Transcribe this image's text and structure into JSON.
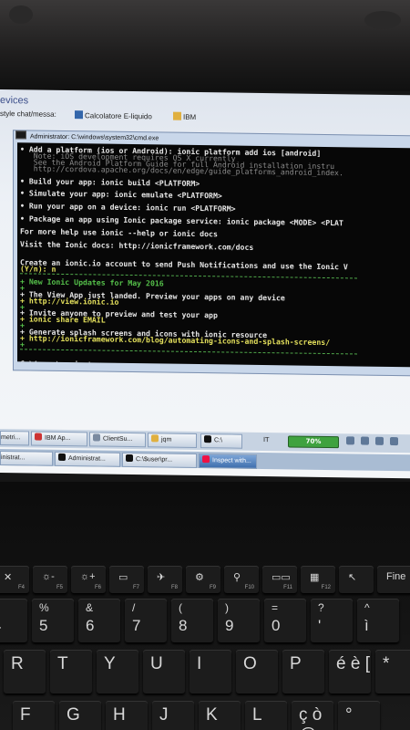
{
  "browser": {
    "title_fragment": "evices",
    "favorites": [
      "style chat/messa:",
      "Calcolatore E-liquido",
      "IBM"
    ]
  },
  "cmd": {
    "title": "Administrator: C:\\windows\\system32\\cmd.exe",
    "icon_label": "C:\\",
    "lines": [
      {
        "text": "• Add a platform (ios or Android): ionic platform add ios [android]",
        "style": ""
      },
      {
        "text": "   Note: iOS development requires OS X currently",
        "style": "gray"
      },
      {
        "text": "   See the Android Platform Guide for full Android installation instru",
        "style": "gray"
      },
      {
        "text": "   http://cordova.apache.org/docs/en/edge/guide_platforms_android_index.",
        "style": "gray"
      },
      {
        "text": "",
        "style": ""
      },
      {
        "text": "• Build your app: ionic build <PLATFORM>",
        "style": ""
      },
      {
        "text": "",
        "style": ""
      },
      {
        "text": "• Simulate your app: ionic emulate <PLATFORM>",
        "style": ""
      },
      {
        "text": "",
        "style": ""
      },
      {
        "text": "• Run your app on a device: ionic run <PLATFORM>",
        "style": ""
      },
      {
        "text": "",
        "style": ""
      },
      {
        "text": "• Package an app using Ionic package service: ionic package <MODE> <PLAT",
        "style": ""
      },
      {
        "text": "",
        "style": ""
      },
      {
        "text": "For more help use ionic --help or ionic docs",
        "style": ""
      },
      {
        "text": "",
        "style": ""
      },
      {
        "text": "Visit the Ionic docs: http://ionicframework.com/docs",
        "style": ""
      },
      {
        "text": "",
        "style": ""
      },
      {
        "text": "",
        "style": ""
      },
      {
        "text": "Create an ionic.io account to send Push Notifications and use the Ionic V",
        "style": ""
      },
      {
        "text": "(Y/n): n",
        "style": "yn"
      },
      {
        "text": "",
        "style": "rule"
      },
      {
        "text": "+ New Ionic Updates for May 2016",
        "style": "green"
      },
      {
        "text": "+",
        "style": "green"
      },
      {
        "text": "+ The View App just landed. Preview your apps on any device",
        "style": ""
      },
      {
        "text": "+ http://view.ionic.io",
        "style": "yellow"
      },
      {
        "text": "+",
        "style": "green"
      },
      {
        "text": "+ Invite anyone to preview and test your app",
        "style": ""
      },
      {
        "text": "+ ionic share EMAIL",
        "style": "yellow"
      },
      {
        "text": "+",
        "style": "green"
      },
      {
        "text": "+ Generate splash screens and icons with ionic resource",
        "style": ""
      },
      {
        "text": "+ http://ionicframework.com/blog/automating-icons-and-splash-screens/",
        "style": "yellow"
      },
      {
        "text": "+",
        "style": "green"
      },
      {
        "text": "",
        "style": "rule"
      },
      {
        "text": "",
        "style": ""
      },
      {
        "text": "C:\\$user\\projects>_",
        "style": ""
      }
    ]
  },
  "taskbar_top": {
    "items": [
      "metri...",
      "IBM Ap...",
      "ClientSu...",
      "jqm",
      "C:\\"
    ],
    "it_label": "IT",
    "battery": "70%"
  },
  "taskbar_bottom": {
    "items": [
      "inistrat...",
      "Administrat...",
      "C:\\$user\\pr...",
      "Inspect with..."
    ]
  },
  "keyboard": {
    "fn_row": [
      {
        "main": "✕",
        "sub": "F4"
      },
      {
        "main": "☼-",
        "sub": "F5"
      },
      {
        "main": "☼+",
        "sub": "F6"
      },
      {
        "main": "▭",
        "sub": "F7"
      },
      {
        "main": "✈",
        "sub": "F8"
      },
      {
        "main": "⚙",
        "sub": "F9"
      },
      {
        "main": "⚲",
        "sub": "F10"
      },
      {
        "main": "▭▭",
        "sub": "F11"
      },
      {
        "main": "▦",
        "sub": "F12"
      },
      {
        "main": "↖",
        "sub": ""
      },
      {
        "main": "Fine",
        "sub": ""
      }
    ],
    "num_row": [
      {
        "top": "$",
        "bot": "4"
      },
      {
        "top": "%",
        "bot": "5"
      },
      {
        "top": "&",
        "bot": "6"
      },
      {
        "top": "/",
        "bot": "7"
      },
      {
        "top": "(",
        "bot": "8"
      },
      {
        "top": ")",
        "bot": "9"
      },
      {
        "top": "=",
        "bot": "0"
      },
      {
        "top": "?",
        "bot": "'"
      },
      {
        "top": "^",
        "bot": "ì"
      }
    ],
    "qwerty_row": [
      "R",
      "T",
      "Y",
      "U",
      "I",
      "O",
      "P",
      "é è [",
      "*"
    ],
    "asdf_row": [
      "F",
      "G",
      "H",
      "J",
      "K",
      "L",
      "ç ò @",
      "°"
    ]
  }
}
